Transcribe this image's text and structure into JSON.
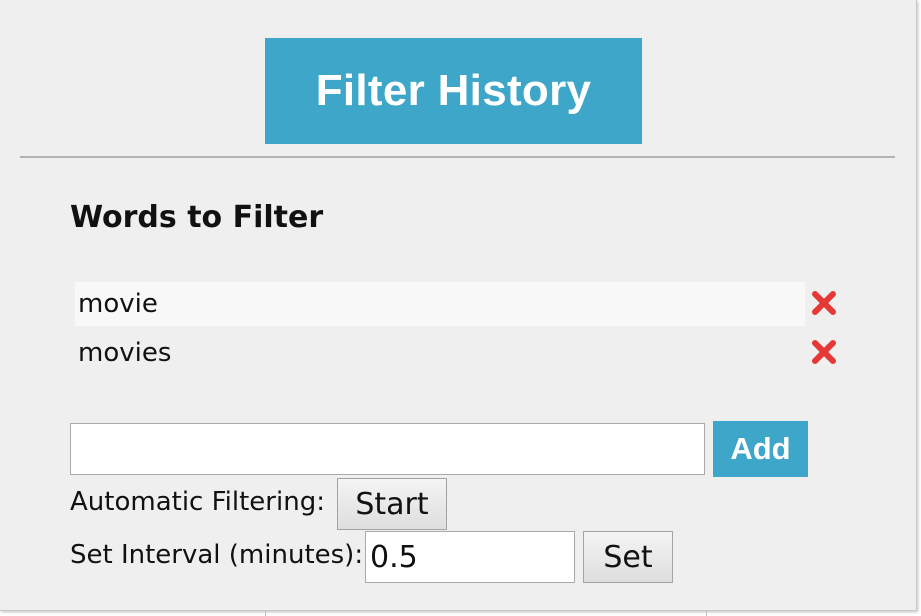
{
  "colors": {
    "accent": "#3ea6c9",
    "remove": "#e53935",
    "panel_bg": "#efefef"
  },
  "header": {
    "title": "Filter History"
  },
  "section": {
    "title": "Words to Filter"
  },
  "words": [
    {
      "text": "movie",
      "remove_icon": "close-x-icon"
    },
    {
      "text": "movies",
      "remove_icon": "close-x-icon"
    }
  ],
  "add_form": {
    "input_value": "",
    "button_label": "Add"
  },
  "auto_filter": {
    "label": "Automatic Filtering:",
    "button_label": "Start"
  },
  "interval": {
    "label": "Set Interval (minutes):",
    "value": "0.5",
    "button_label": "Set"
  }
}
